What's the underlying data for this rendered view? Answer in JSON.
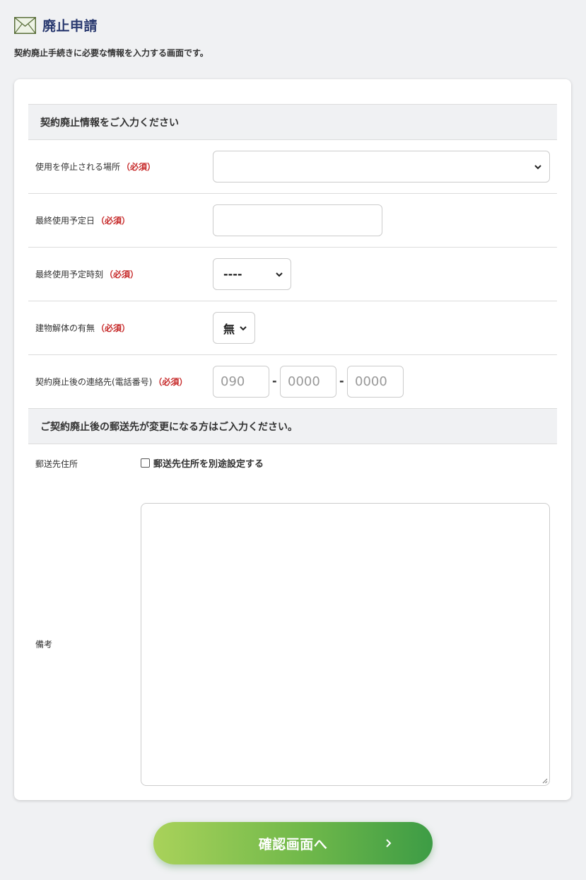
{
  "header": {
    "icon": "envelope-icon",
    "title": "廃止申請",
    "description": "契約廃止手続きに必要な情報を入力する画面です。"
  },
  "form": {
    "section1_title": "契約廃止情報をご入力ください",
    "required_mark": "（必須）",
    "fields": {
      "location": {
        "label": "使用を停止される場所",
        "value": ""
      },
      "last_date": {
        "label": "最終使用予定日",
        "value": ""
      },
      "last_time": {
        "label": "最終使用予定時刻",
        "value": "----"
      },
      "demolition": {
        "label": "建物解体の有無",
        "value": "無"
      },
      "phone": {
        "label": "契約廃止後の連絡先(電話番号)",
        "part1_placeholder": "090",
        "part2_placeholder": "0000",
        "part3_placeholder": "0000",
        "separator": "-"
      }
    },
    "section2_title": "ご契約廃止後の郵送先が変更になる方はご入力ください。",
    "mailing": {
      "label": "郵送先住所",
      "checkbox_label": "郵送先住所を別途設定する",
      "checked": false
    },
    "notes": {
      "label": "備考",
      "value": ""
    }
  },
  "actions": {
    "confirm_label": "確認画面へ",
    "confirm_arrow": "chevron-right-icon"
  },
  "colors": {
    "title": "#2a3a70",
    "required": "#c62828",
    "button_start": "#a9d25a",
    "button_end": "#3d9c45"
  }
}
